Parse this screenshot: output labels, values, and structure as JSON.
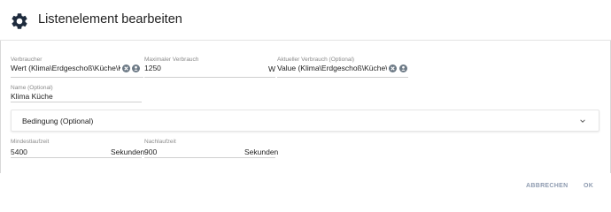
{
  "dialog": {
    "title": "Listenelement bearbeiten"
  },
  "fields": {
    "verbraucher": {
      "label": "Verbraucher",
      "value": "Wert (Klima\\Erdgeschoß\\Küche\\Klima Küche)"
    },
    "max_verbrauch": {
      "label": "Maximaler Verbrauch",
      "value": "1250",
      "unit": "W"
    },
    "aktueller_verbrauch": {
      "label": "Aktueller Verbrauch (Optional)",
      "value": "Value (Klima\\Erdgeschoß\\Küche\\Klima Küche)"
    },
    "name": {
      "label": "Name (Optional)",
      "value": "Klima Küche"
    },
    "mindestlaufzeit": {
      "label": "Mindestlaufzeit",
      "value": "5400",
      "unit": "Sekunden"
    },
    "nachlaufzeit": {
      "label": "Nachlaufzeit",
      "value": "900",
      "unit": "Sekunden"
    }
  },
  "bedingung": {
    "label": "Bedingung (Optional)"
  },
  "buttons": {
    "cancel": "ABBRECHEN",
    "ok": "OK"
  },
  "icons": {
    "header": "gear-icon",
    "clear": "clear-icon",
    "select": "select-object-icon",
    "expand": "chevron-down-icon"
  },
  "colors": {
    "accent": "#1e2b3d",
    "button": "#8e9bb0",
    "icon": "#6d7a86"
  }
}
